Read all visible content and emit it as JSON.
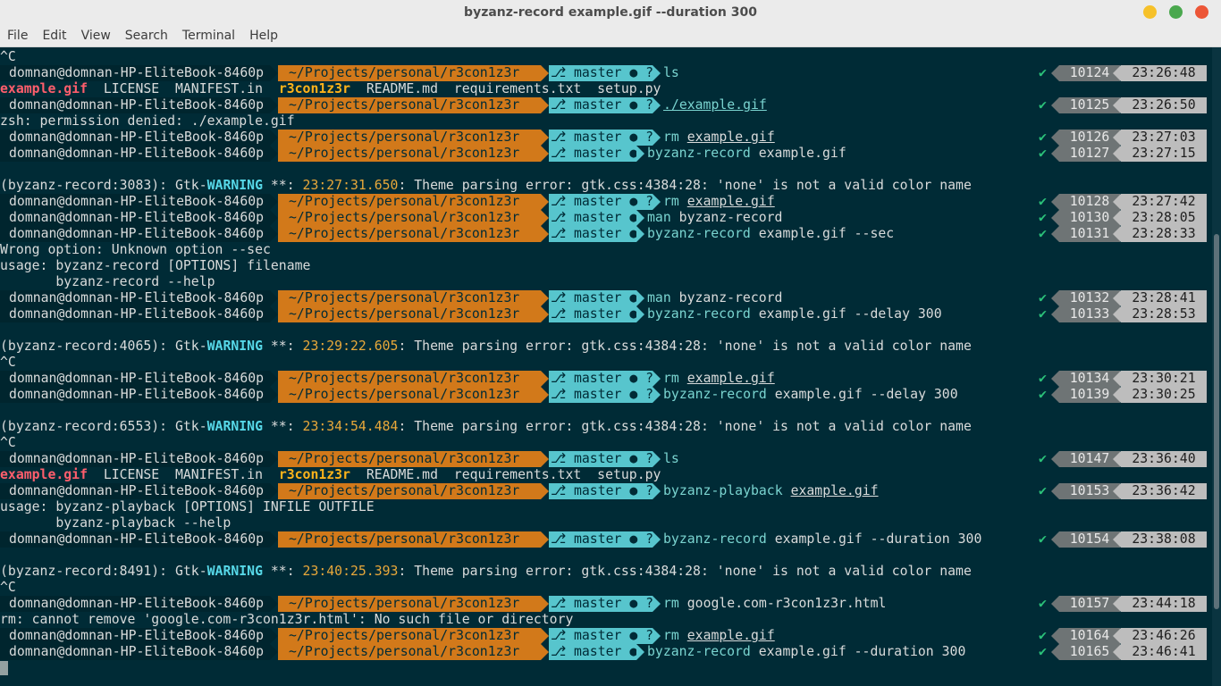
{
  "window": {
    "title": "byzanz-record example.gif --duration 300"
  },
  "menu": [
    "File",
    "Edit",
    "View",
    "Search",
    "Terminal",
    "Help"
  ],
  "prompt": {
    "user": "domnan@domnan-HP-EliteBook-8460p",
    "path": "~/Projects/personal/r3con1z3r",
    "branch_icon": "git-branch-icon",
    "branch": "master",
    "ok_mark": "✔"
  },
  "lines": [
    {
      "type": "text",
      "parts": [
        {
          "t": "^C"
        }
      ]
    },
    {
      "type": "prompt",
      "status": "●?",
      "cmd": "ls",
      "args": "",
      "num": "10124",
      "time": "23:26:48"
    },
    {
      "type": "text",
      "parts": [
        {
          "t": "example.gif",
          "c": "red"
        },
        {
          "t": "  LICENSE  MANIFEST.in  "
        },
        {
          "t": "r3con1z3r",
          "c": "yel"
        },
        {
          "t": "  README.md  requirements.txt  setup.py"
        }
      ]
    },
    {
      "type": "prompt",
      "status": "●?",
      "cmd": "./example.gif",
      "cmd_u": true,
      "args": "",
      "num": "10125",
      "time": "23:26:50"
    },
    {
      "type": "text",
      "parts": [
        {
          "t": "zsh: permission denied: ./example.gif"
        }
      ]
    },
    {
      "type": "prompt",
      "status": "●?",
      "cmd": "rm",
      "args": "example.gif",
      "args_u": true,
      "num": "10126",
      "time": "23:27:03"
    },
    {
      "type": "prompt",
      "status": "●",
      "cmd": "byzanz-record",
      "args": "example.gif",
      "num": "10127",
      "time": "23:27:15"
    },
    {
      "type": "text",
      "parts": [
        {
          "t": ""
        }
      ]
    },
    {
      "type": "text",
      "parts": [
        {
          "t": "(byzanz-record:3083): Gtk-"
        },
        {
          "t": "WARNING",
          "c": "warn"
        },
        {
          "t": " **: "
        },
        {
          "t": "23:27:31.650",
          "c": "ts"
        },
        {
          "t": ": Theme parsing error: gtk.css:4384:28: 'none' is not a valid color name"
        }
      ]
    },
    {
      "type": "prompt",
      "status": "●?",
      "cmd": "rm",
      "args": "example.gif",
      "args_u": true,
      "num": "10128",
      "time": "23:27:42"
    },
    {
      "type": "prompt",
      "status": "●",
      "cmd": "man",
      "args": "byzanz-record",
      "num": "10130",
      "time": "23:28:05"
    },
    {
      "type": "prompt",
      "status": "●",
      "cmd": "byzanz-record",
      "args": "example.gif --sec",
      "num": "10131",
      "time": "23:28:33"
    },
    {
      "type": "text",
      "parts": [
        {
          "t": "Wrong option: Unknown option --sec"
        }
      ]
    },
    {
      "type": "text",
      "parts": [
        {
          "t": "usage: byzanz-record [OPTIONS] filename"
        }
      ]
    },
    {
      "type": "text",
      "parts": [
        {
          "t": "       byzanz-record --help"
        }
      ]
    },
    {
      "type": "prompt",
      "status": "●",
      "cmd": "man",
      "args": "byzanz-record",
      "num": "10132",
      "time": "23:28:41"
    },
    {
      "type": "prompt",
      "status": "●",
      "cmd": "byzanz-record",
      "args": "example.gif --delay 300",
      "num": "10133",
      "time": "23:28:53"
    },
    {
      "type": "text",
      "parts": [
        {
          "t": ""
        }
      ]
    },
    {
      "type": "text",
      "parts": [
        {
          "t": "(byzanz-record:4065): Gtk-"
        },
        {
          "t": "WARNING",
          "c": "warn"
        },
        {
          "t": " **: "
        },
        {
          "t": "23:29:22.605",
          "c": "ts"
        },
        {
          "t": ": Theme parsing error: gtk.css:4384:28: 'none' is not a valid color name"
        }
      ]
    },
    {
      "type": "text",
      "parts": [
        {
          "t": "^C"
        }
      ]
    },
    {
      "type": "prompt",
      "status": "●?",
      "cmd": "rm",
      "args": "example.gif",
      "args_u": true,
      "num": "10134",
      "time": "23:30:21"
    },
    {
      "type": "prompt",
      "status": "●?",
      "cmd": "byzanz-record",
      "args": "example.gif --delay 300",
      "num": "10139",
      "time": "23:30:25"
    },
    {
      "type": "text",
      "parts": [
        {
          "t": ""
        }
      ]
    },
    {
      "type": "text",
      "parts": [
        {
          "t": "(byzanz-record:6553): Gtk-"
        },
        {
          "t": "WARNING",
          "c": "warn"
        },
        {
          "t": " **: "
        },
        {
          "t": "23:34:54.484",
          "c": "ts"
        },
        {
          "t": ": Theme parsing error: gtk.css:4384:28: 'none' is not a valid color name"
        }
      ]
    },
    {
      "type": "text",
      "parts": [
        {
          "t": "^C"
        }
      ]
    },
    {
      "type": "prompt",
      "status": "●?",
      "cmd": "ls",
      "args": "",
      "num": "10147",
      "time": "23:36:40"
    },
    {
      "type": "text",
      "parts": [
        {
          "t": "example.gif",
          "c": "red"
        },
        {
          "t": "  LICENSE  MANIFEST.in  "
        },
        {
          "t": "r3con1z3r",
          "c": "yel"
        },
        {
          "t": "  README.md  requirements.txt  setup.py"
        }
      ]
    },
    {
      "type": "prompt",
      "status": "●?",
      "cmd": "byzanz-playback",
      "args": "example.gif",
      "args_u": true,
      "num": "10153",
      "time": "23:36:42"
    },
    {
      "type": "text",
      "parts": [
        {
          "t": "usage: byzanz-playback [OPTIONS] INFILE OUTFILE"
        }
      ]
    },
    {
      "type": "text",
      "parts": [
        {
          "t": "       byzanz-playback --help"
        }
      ]
    },
    {
      "type": "prompt",
      "status": "●?",
      "cmd": "byzanz-record",
      "args": "example.gif --duration 300",
      "num": "10154",
      "time": "23:38:08"
    },
    {
      "type": "text",
      "parts": [
        {
          "t": ""
        }
      ]
    },
    {
      "type": "text",
      "parts": [
        {
          "t": "(byzanz-record:8491): Gtk-"
        },
        {
          "t": "WARNING",
          "c": "warn"
        },
        {
          "t": " **: "
        },
        {
          "t": "23:40:25.393",
          "c": "ts"
        },
        {
          "t": ": Theme parsing error: gtk.css:4384:28: 'none' is not a valid color name"
        }
      ]
    },
    {
      "type": "text",
      "parts": [
        {
          "t": "^C"
        }
      ]
    },
    {
      "type": "prompt",
      "status": "●?",
      "cmd": "rm",
      "args": "google.com-r3con1z3r.html",
      "num": "10157",
      "time": "23:44:18"
    },
    {
      "type": "text",
      "parts": [
        {
          "t": "rm: cannot remove 'google.com-r3con1z3r.html': No such file or directory"
        }
      ]
    },
    {
      "type": "prompt",
      "status": "●?",
      "cmd": "rm",
      "args": "example.gif",
      "args_u": true,
      "num": "10164",
      "time": "23:46:26"
    },
    {
      "type": "prompt",
      "status": "●",
      "cmd": "byzanz-record",
      "args": "example.gif --duration 300",
      "num": "10165",
      "time": "23:46:41"
    },
    {
      "type": "cursor"
    }
  ],
  "colors": {
    "background": "#002b36",
    "path_segment": "#d2791a",
    "git_segment": "#57c5cd",
    "ok": "#2bc27a"
  }
}
